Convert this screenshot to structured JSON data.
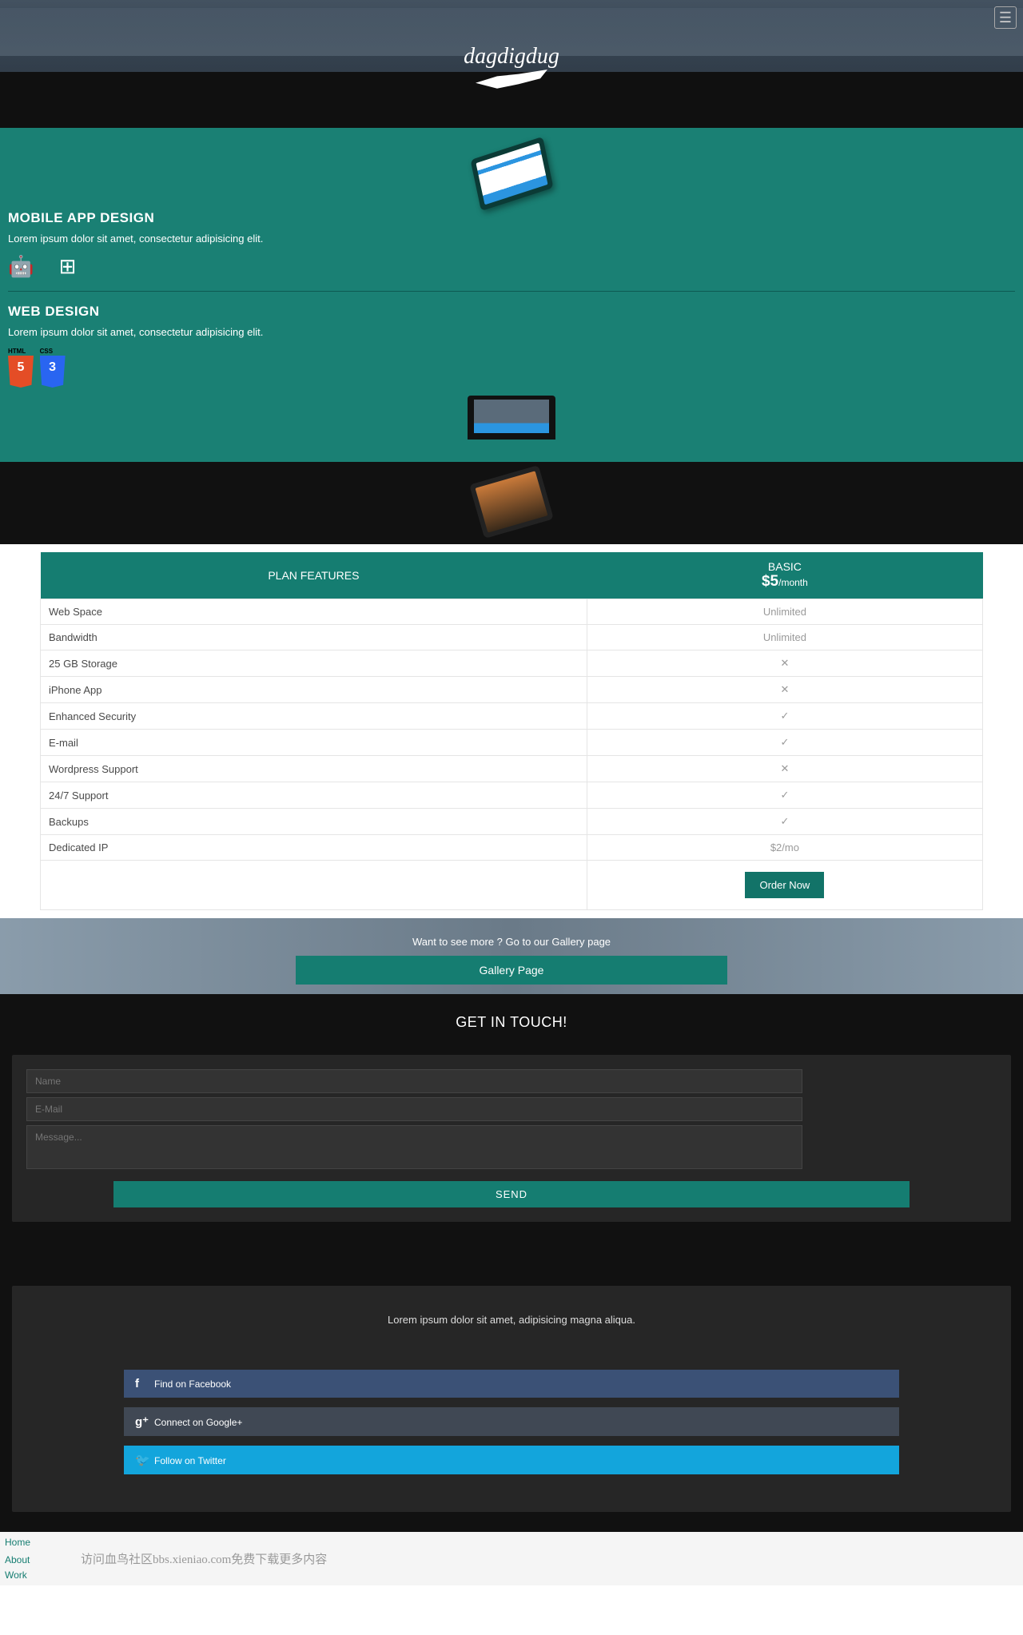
{
  "hero": {
    "logo_text": "dagdigdug"
  },
  "mobile": {
    "title": "MOBILE APP DESIGN",
    "desc": "Lorem ipsum dolor sit amet, consectetur adipisicing elit."
  },
  "web": {
    "title": "WEB DESIGN",
    "desc": "Lorem ipsum dolor sit amet, consectetur adipisicing elit.",
    "html_label": "HTML",
    "css_label": "CSS",
    "html5": "5",
    "css3": "3"
  },
  "pricing": {
    "header_features": "PLAN FEATURES",
    "header_plan": "BASIC",
    "price": "$5",
    "period": "/month",
    "rows": [
      {
        "label": "Web Space",
        "value": "Unlimited",
        "type": "text"
      },
      {
        "label": "Bandwidth",
        "value": "Unlimited",
        "type": "text"
      },
      {
        "label": "25 GB Storage",
        "value": "✕",
        "type": "cross"
      },
      {
        "label": "iPhone App",
        "value": "✕",
        "type": "cross"
      },
      {
        "label": "Enhanced Security",
        "value": "✓",
        "type": "check"
      },
      {
        "label": "E-mail",
        "value": "✓",
        "type": "check"
      },
      {
        "label": "Wordpress Support",
        "value": "✕",
        "type": "cross"
      },
      {
        "label": "24/7 Support",
        "value": "✓",
        "type": "check"
      },
      {
        "label": "Backups",
        "value": "✓",
        "type": "check"
      },
      {
        "label": "Dedicated IP",
        "value": "$2/mo",
        "type": "text"
      }
    ],
    "order_btn": "Order Now"
  },
  "gallery": {
    "prompt": "Want to see more ? Go to our Gallery page",
    "btn": "Gallery Page"
  },
  "contact": {
    "title": "GET IN TOUCH!",
    "name_ph": "Name",
    "email_ph": "E-Mail",
    "msg_ph": "Message...",
    "send": "SEND"
  },
  "social": {
    "text": "Lorem ipsum dolor sit amet, adipisicing magna aliqua.",
    "fb": "Find on Facebook",
    "gp": "Connect on Google+",
    "tw": "Follow on Twitter"
  },
  "footer": {
    "links": [
      "Home",
      "About",
      "Work"
    ],
    "watermark": "访问血鸟社区bbs.xieniao.com免费下载更多内容"
  }
}
